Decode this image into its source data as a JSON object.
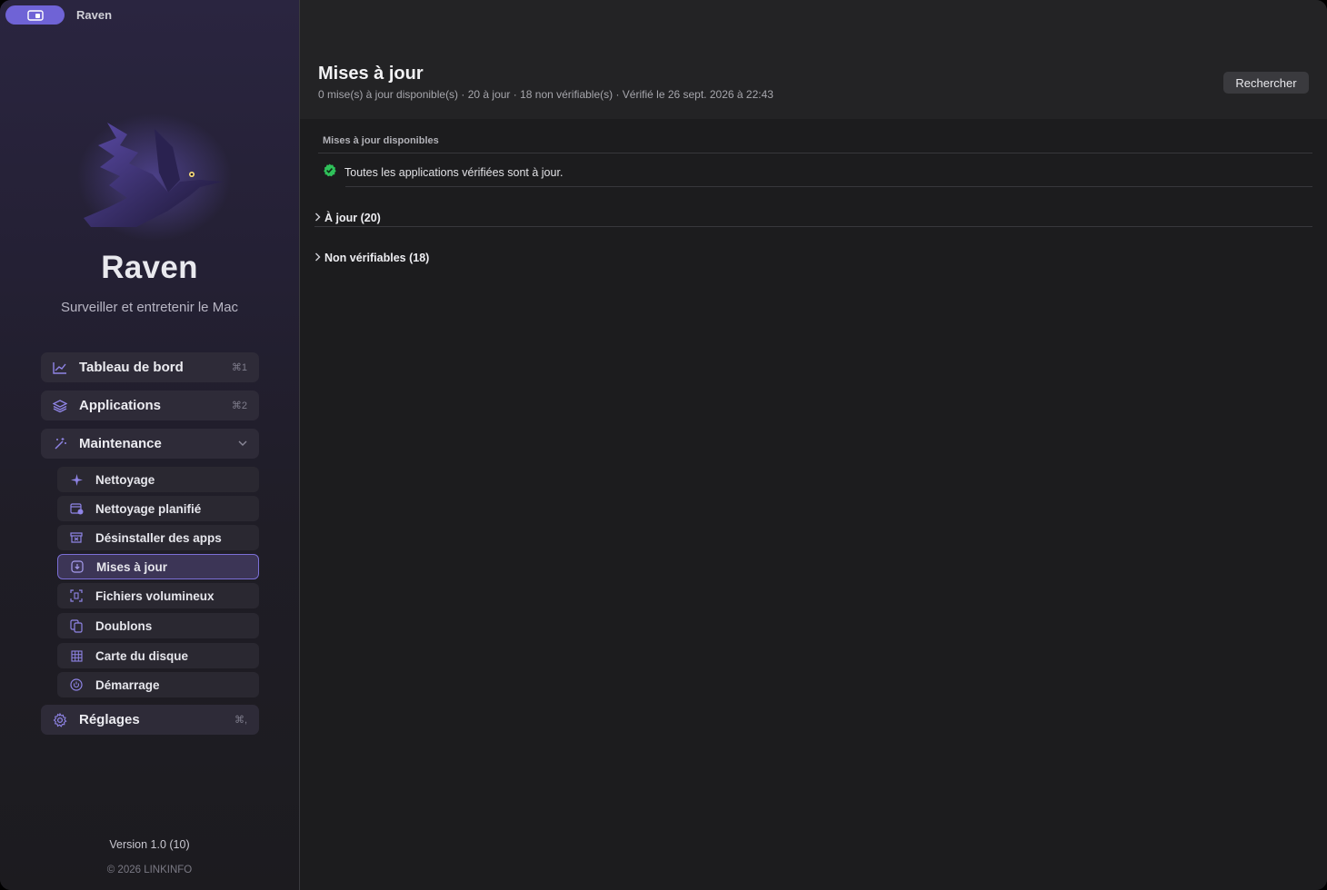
{
  "window": {
    "title": "Raven"
  },
  "brand": {
    "name": "Raven",
    "tagline": "Surveiller et entretenir le Mac",
    "accent": "#6f63d6"
  },
  "nav": {
    "dashboard": {
      "label": "Tableau de bord",
      "shortcut": "⌘1",
      "icon": "chart-line-icon"
    },
    "applications": {
      "label": "Applications",
      "shortcut": "⌘2",
      "icon": "layers-icon"
    },
    "maintenance": {
      "label": "Maintenance",
      "icon": "magic-wand-icon",
      "expanded": true
    },
    "maintenance_items": [
      {
        "label": "Nettoyage",
        "icon": "sparkle-icon"
      },
      {
        "label": "Nettoyage planifié",
        "icon": "calendar-clock-icon"
      },
      {
        "label": "Désinstaller des apps",
        "icon": "trash-box-icon"
      },
      {
        "label": "Mises à jour",
        "icon": "download-icon",
        "selected": true
      },
      {
        "label": "Fichiers volumineux",
        "icon": "scan-file-icon"
      },
      {
        "label": "Doublons",
        "icon": "duplicate-icon"
      },
      {
        "label": "Carte du disque",
        "icon": "grid-icon"
      },
      {
        "label": "Démarrage",
        "icon": "power-icon"
      }
    ],
    "settings": {
      "label": "Réglages",
      "shortcut": "⌘,",
      "icon": "gear-icon"
    }
  },
  "footer": {
    "version": "Version 1.0 (10)",
    "copyright": "© 2026 LINKINFO"
  },
  "main": {
    "title": "Mises à jour",
    "subtitle": "0 mise(s) à jour disponible(s) · 20 à jour · 18 non vérifiable(s) · Vérifié le 26 sept. 2026 à 22:43",
    "search_button": "Rechercher",
    "available_section": "Mises à jour disponibles",
    "status_message": "Toutes les applications vérifiées sont à jour.",
    "status_color": "#2fc15a",
    "groups": [
      {
        "label": "À jour (20)",
        "expanded": false
      },
      {
        "label": "Non vérifiables (18)",
        "expanded": false
      }
    ]
  }
}
